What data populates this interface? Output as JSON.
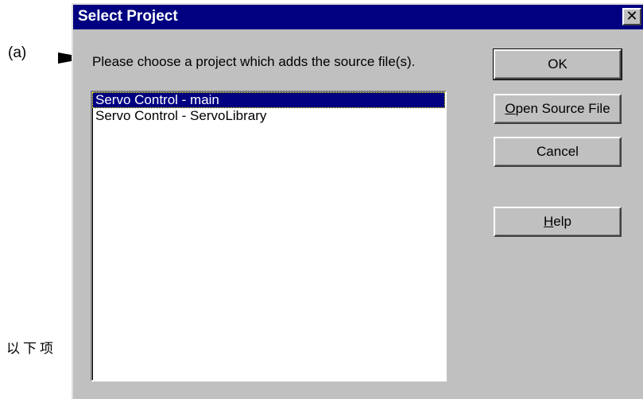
{
  "annotation": {
    "label": "(a)",
    "side_text": "以下项"
  },
  "dialog": {
    "title": "Select Project",
    "close_glyph": "✕",
    "prompt": "Please choose a project which adds the source file(s).",
    "projects": [
      "Servo Control - main",
      "Servo Control - ServoLibrary"
    ],
    "selected_index": 0,
    "buttons": {
      "ok": "OK",
      "open_source_file": {
        "mnemonic": "O",
        "rest": "pen Source File"
      },
      "cancel": "Cancel",
      "help": {
        "mnemonic": "H",
        "rest": "elp"
      }
    }
  }
}
